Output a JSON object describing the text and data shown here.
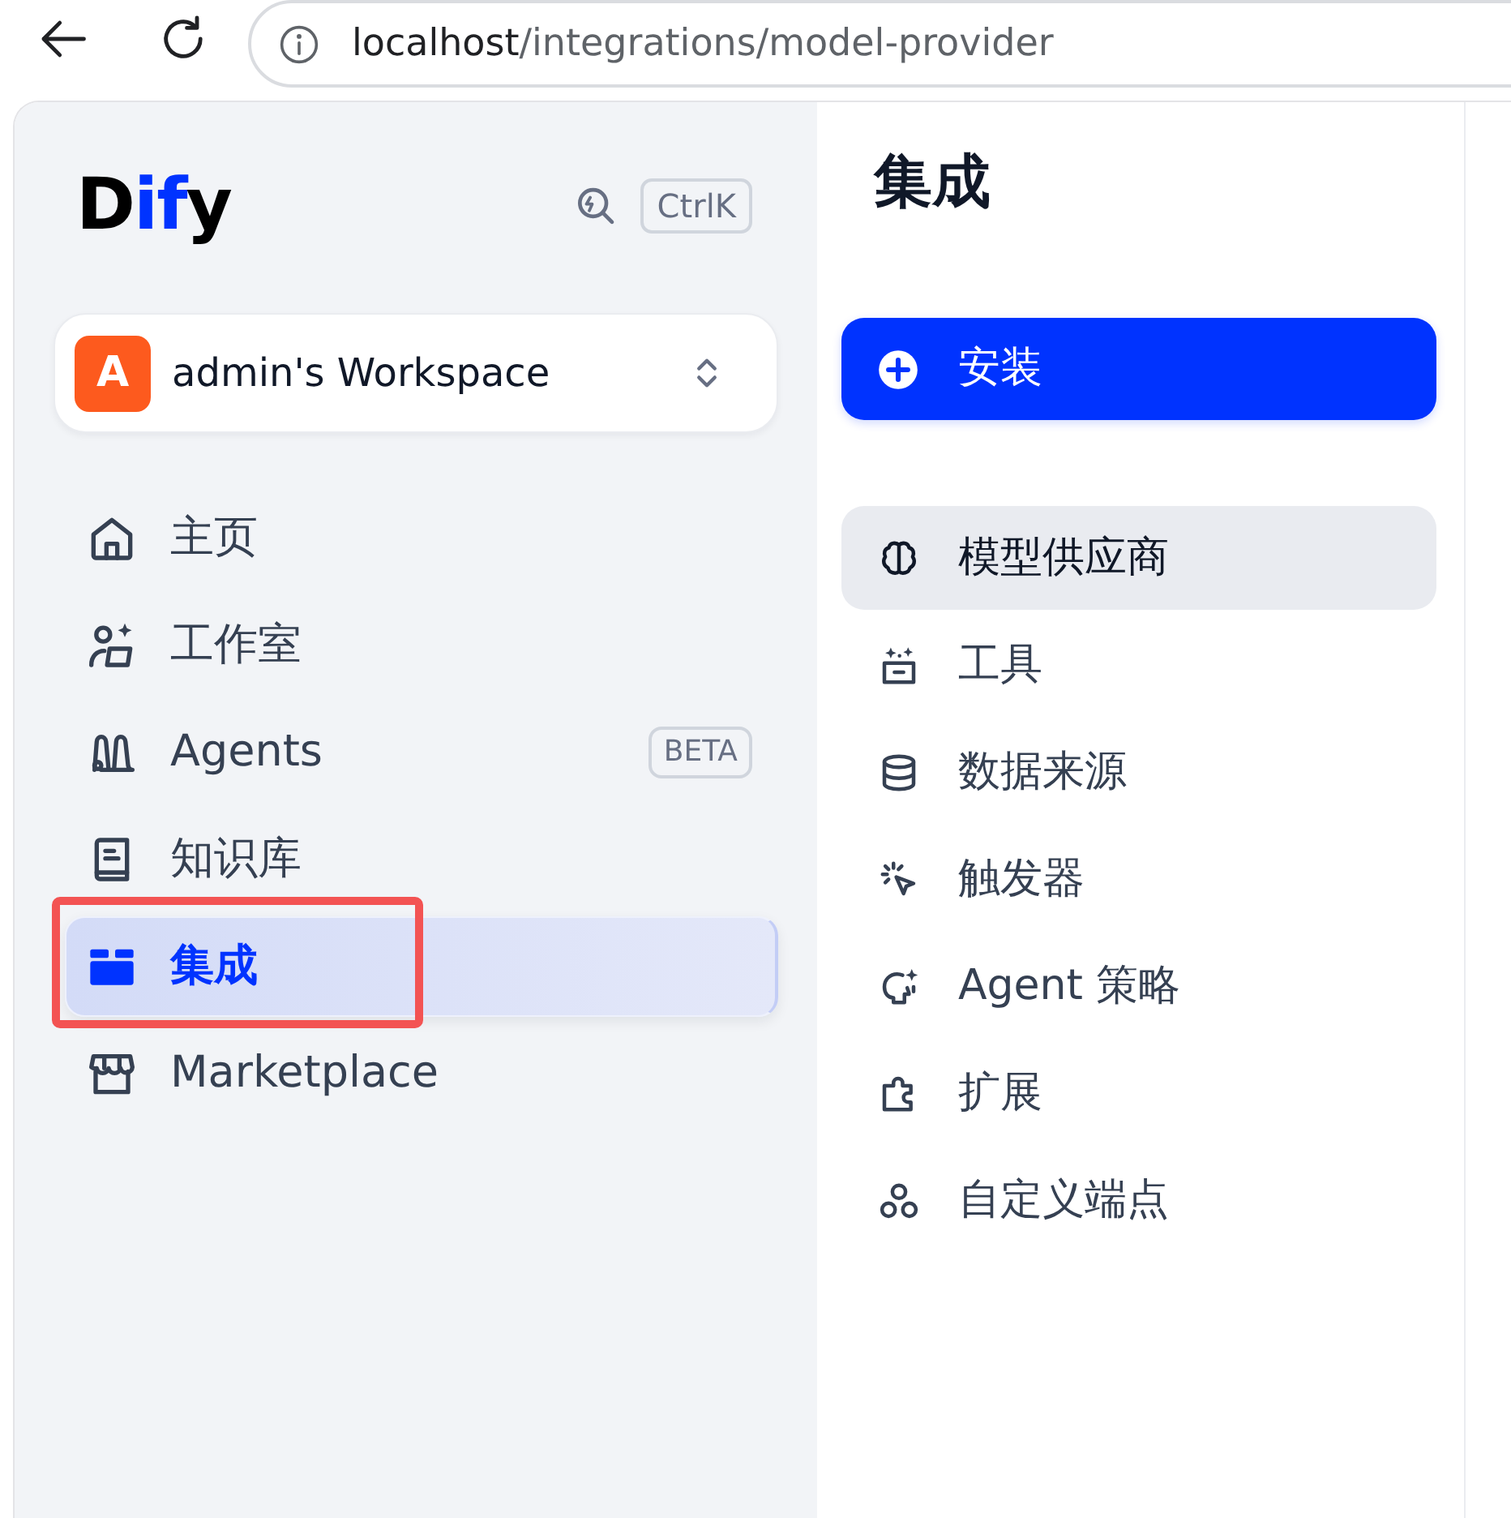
{
  "browser": {
    "url_host": "localhost",
    "url_path": "/integrations/model-provider"
  },
  "sidebar": {
    "logo": [
      {
        "text": "D",
        "accent": false
      },
      {
        "text": "if",
        "accent": true
      },
      {
        "text": "y",
        "accent": false
      }
    ],
    "shortcut": "CtrlK",
    "workspace": {
      "avatar": "A",
      "name": "admin's Workspace"
    },
    "nav_items": [
      {
        "label": "主页",
        "selected": false,
        "annotated": false
      },
      {
        "label": "工作室",
        "selected": false,
        "annotated": false
      },
      {
        "label": "Agents",
        "badge": "BETA",
        "selected": false,
        "annotated": false
      },
      {
        "label": "知识库",
        "selected": false,
        "annotated": false
      },
      {
        "label": "集成",
        "selected": true,
        "annotated": true
      },
      {
        "label": "Marketplace",
        "selected": false,
        "annotated": false
      }
    ]
  },
  "content": {
    "title": "集成",
    "install_button": "安装",
    "categories": [
      {
        "label": "模型供应商",
        "selected": true
      },
      {
        "label": "工具",
        "selected": false
      },
      {
        "label": "数据来源",
        "selected": false
      },
      {
        "label": "触发器",
        "selected": false
      },
      {
        "label": "Agent 策略",
        "selected": false
      },
      {
        "label": "扩展",
        "selected": false
      },
      {
        "label": "自定义端点",
        "selected": false
      }
    ]
  }
}
